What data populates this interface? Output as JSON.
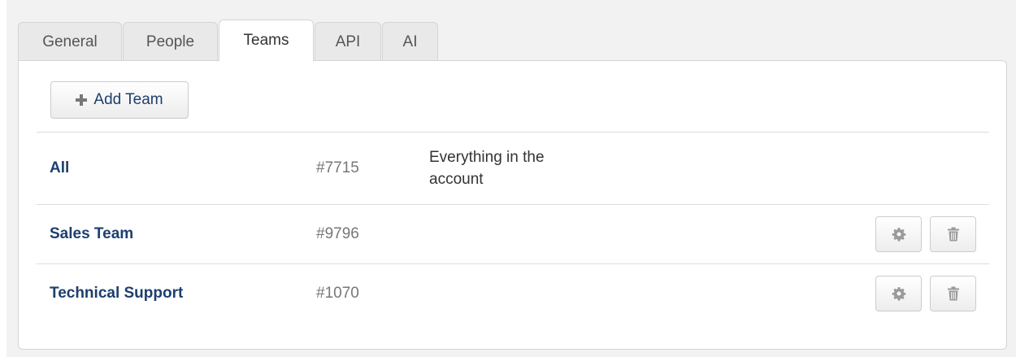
{
  "tabs": [
    {
      "label": "General",
      "active": false
    },
    {
      "label": "People",
      "active": false
    },
    {
      "label": "Teams",
      "active": true
    },
    {
      "label": "API",
      "active": false
    },
    {
      "label": "AI",
      "active": false
    }
  ],
  "toolbar": {
    "add_team_label": "Add Team",
    "add_team_icon": "plus-icon"
  },
  "teams": [
    {
      "name": "All",
      "id": "#7715",
      "description": "Everything in the account",
      "actions": []
    },
    {
      "name": "Sales Team",
      "id": "#9796",
      "description": "",
      "actions": [
        "gear-icon",
        "trash-icon"
      ]
    },
    {
      "name": "Technical Support",
      "id": "#1070",
      "description": "",
      "actions": [
        "gear-icon",
        "trash-icon"
      ]
    }
  ],
  "colors": {
    "link": "#1c3f6e",
    "muted": "#777777",
    "tab_inactive_bg": "#e9e9e9",
    "page_bg": "#f2f2f2"
  }
}
